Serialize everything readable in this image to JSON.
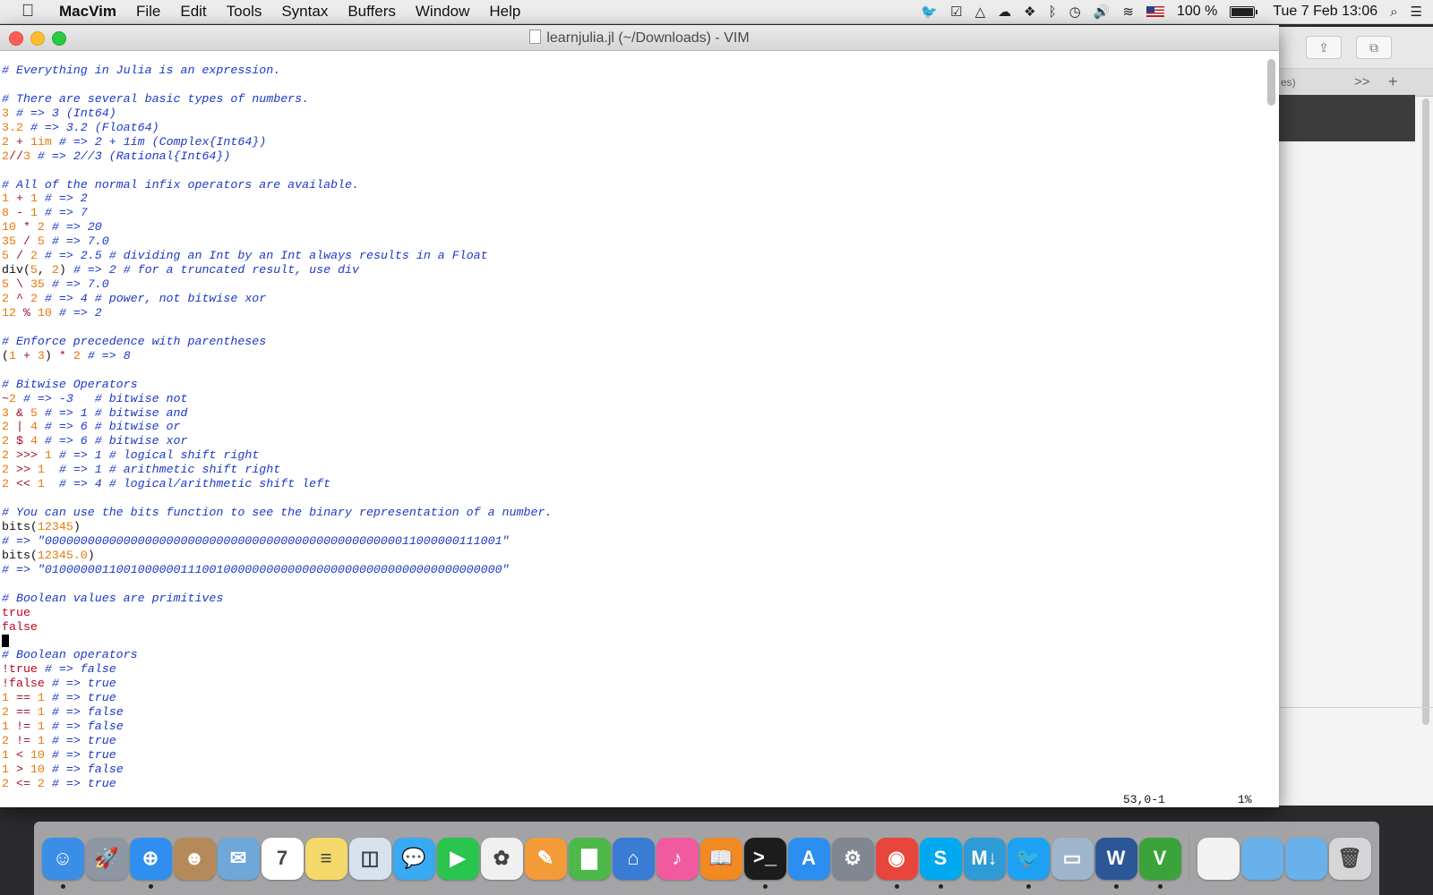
{
  "menubar": {
    "app_name": "MacVim",
    "items": [
      "File",
      "Edit",
      "Tools",
      "Syntax",
      "Buffers",
      "Window",
      "Help"
    ],
    "battery": "100 %",
    "clock": "Tue 7 Feb  13:06",
    "status_icons": [
      "twitter-icon",
      "tasks-icon",
      "drive-icon",
      "cloud-icon",
      "dropbox-icon",
      "bluetooth-icon",
      "time-machine-icon",
      "volume-icon",
      "wifi-icon",
      "flag-icon",
      "battery-icon",
      "spotlight-icon",
      "notification-center-icon"
    ]
  },
  "window": {
    "title": "learnjulia.jl (~/Downloads) - VIM"
  },
  "editor": {
    "cursor_line": 41,
    "status_position": "53,0-1",
    "status_percent": "1%",
    "lines": [
      [
        [
          "c",
          "# Everything in Julia is an expression."
        ]
      ],
      [],
      [
        [
          "c",
          "# There are several basic types of numbers."
        ]
      ],
      [
        [
          "n",
          "3"
        ],
        [
          "p",
          " "
        ],
        [
          "c",
          "# => 3 (Int64)"
        ]
      ],
      [
        [
          "n",
          "3.2"
        ],
        [
          "p",
          " "
        ],
        [
          "c",
          "# => 3.2 (Float64)"
        ]
      ],
      [
        [
          "n",
          "2"
        ],
        [
          "p",
          " "
        ],
        [
          "o",
          "+"
        ],
        [
          "p",
          " "
        ],
        [
          "n",
          "1im"
        ],
        [
          "p",
          " "
        ],
        [
          "c",
          "# => 2 + 1im (Complex{Int64})"
        ]
      ],
      [
        [
          "n",
          "2"
        ],
        [
          "o",
          "//"
        ],
        [
          "n",
          "3"
        ],
        [
          "p",
          " "
        ],
        [
          "c",
          "# => 2//3 (Rational{Int64})"
        ]
      ],
      [],
      [
        [
          "c",
          "# All of the normal infix operators are available."
        ]
      ],
      [
        [
          "n",
          "1"
        ],
        [
          "p",
          " "
        ],
        [
          "o",
          "+"
        ],
        [
          "p",
          " "
        ],
        [
          "n",
          "1"
        ],
        [
          "p",
          " "
        ],
        [
          "c",
          "# => 2"
        ]
      ],
      [
        [
          "n",
          "8"
        ],
        [
          "p",
          " "
        ],
        [
          "o",
          "-"
        ],
        [
          "p",
          " "
        ],
        [
          "n",
          "1"
        ],
        [
          "p",
          " "
        ],
        [
          "c",
          "# => 7"
        ]
      ],
      [
        [
          "n",
          "10"
        ],
        [
          "p",
          " "
        ],
        [
          "o",
          "*"
        ],
        [
          "p",
          " "
        ],
        [
          "n",
          "2"
        ],
        [
          "p",
          " "
        ],
        [
          "c",
          "# => 20"
        ]
      ],
      [
        [
          "n",
          "35"
        ],
        [
          "p",
          " "
        ],
        [
          "o",
          "/"
        ],
        [
          "p",
          " "
        ],
        [
          "n",
          "5"
        ],
        [
          "p",
          " "
        ],
        [
          "c",
          "# => 7.0"
        ]
      ],
      [
        [
          "n",
          "5"
        ],
        [
          "p",
          " "
        ],
        [
          "o",
          "/"
        ],
        [
          "p",
          " "
        ],
        [
          "n",
          "2"
        ],
        [
          "p",
          " "
        ],
        [
          "c",
          "# => 2.5 # dividing an Int by an Int always results in a Float"
        ]
      ],
      [
        [
          "p",
          "div("
        ],
        [
          "n",
          "5"
        ],
        [
          "p",
          ", "
        ],
        [
          "n",
          "2"
        ],
        [
          "p",
          ") "
        ],
        [
          "c",
          "# => 2 # for a truncated result, use div"
        ]
      ],
      [
        [
          "n",
          "5"
        ],
        [
          "p",
          " "
        ],
        [
          "o",
          "\\"
        ],
        [
          "p",
          " "
        ],
        [
          "n",
          "35"
        ],
        [
          "p",
          " "
        ],
        [
          "c",
          "# => 7.0"
        ]
      ],
      [
        [
          "n",
          "2"
        ],
        [
          "p",
          " "
        ],
        [
          "o",
          "^"
        ],
        [
          "p",
          " "
        ],
        [
          "n",
          "2"
        ],
        [
          "p",
          " "
        ],
        [
          "c",
          "# => 4 # power, not bitwise xor"
        ]
      ],
      [
        [
          "n",
          "12"
        ],
        [
          "p",
          " "
        ],
        [
          "o",
          "%"
        ],
        [
          "p",
          " "
        ],
        [
          "n",
          "10"
        ],
        [
          "p",
          " "
        ],
        [
          "c",
          "# => 2"
        ]
      ],
      [],
      [
        [
          "c",
          "# Enforce precedence with parentheses"
        ]
      ],
      [
        [
          "p",
          "("
        ],
        [
          "n",
          "1"
        ],
        [
          "p",
          " "
        ],
        [
          "o",
          "+"
        ],
        [
          "p",
          " "
        ],
        [
          "n",
          "3"
        ],
        [
          "p",
          ") "
        ],
        [
          "o",
          "*"
        ],
        [
          "p",
          " "
        ],
        [
          "n",
          "2"
        ],
        [
          "p",
          " "
        ],
        [
          "c",
          "# => 8"
        ]
      ],
      [],
      [
        [
          "c",
          "# Bitwise Operators"
        ]
      ],
      [
        [
          "o",
          "~"
        ],
        [
          "n",
          "2"
        ],
        [
          "p",
          " "
        ],
        [
          "c",
          "# => -3   # bitwise not"
        ]
      ],
      [
        [
          "n",
          "3"
        ],
        [
          "p",
          " "
        ],
        [
          "o",
          "&"
        ],
        [
          "p",
          " "
        ],
        [
          "n",
          "5"
        ],
        [
          "p",
          " "
        ],
        [
          "c",
          "# => 1 # bitwise and"
        ]
      ],
      [
        [
          "n",
          "2"
        ],
        [
          "p",
          " "
        ],
        [
          "o",
          "|"
        ],
        [
          "p",
          " "
        ],
        [
          "n",
          "4"
        ],
        [
          "p",
          " "
        ],
        [
          "c",
          "# => 6 # bitwise or"
        ]
      ],
      [
        [
          "n",
          "2"
        ],
        [
          "p",
          " "
        ],
        [
          "o",
          "$"
        ],
        [
          "p",
          " "
        ],
        [
          "n",
          "4"
        ],
        [
          "p",
          " "
        ],
        [
          "c",
          "# => 6 # bitwise xor"
        ]
      ],
      [
        [
          "n",
          "2"
        ],
        [
          "p",
          " "
        ],
        [
          "o",
          ">>>"
        ],
        [
          "p",
          " "
        ],
        [
          "n",
          "1"
        ],
        [
          "p",
          " "
        ],
        [
          "c",
          "# => 1 # logical shift right"
        ]
      ],
      [
        [
          "n",
          "2"
        ],
        [
          "p",
          " "
        ],
        [
          "o",
          ">>"
        ],
        [
          "p",
          " "
        ],
        [
          "n",
          "1"
        ],
        [
          "p",
          "  "
        ],
        [
          "c",
          "# => 1 # arithmetic shift right"
        ]
      ],
      [
        [
          "n",
          "2"
        ],
        [
          "p",
          " "
        ],
        [
          "o",
          "<<"
        ],
        [
          "p",
          " "
        ],
        [
          "n",
          "1"
        ],
        [
          "p",
          "  "
        ],
        [
          "c",
          "# => 4 # logical/arithmetic shift left"
        ]
      ],
      [],
      [
        [
          "c",
          "# You can use the bits function to see the binary representation of a number."
        ]
      ],
      [
        [
          "p",
          "bits("
        ],
        [
          "n",
          "12345"
        ],
        [
          "p",
          ")"
        ]
      ],
      [
        [
          "c",
          "# => \"0000000000000000000000000000000000000000000000000011000000111001\""
        ]
      ],
      [
        [
          "p",
          "bits("
        ],
        [
          "n",
          "12345.0"
        ],
        [
          "p",
          ")"
        ]
      ],
      [
        [
          "c",
          "# => \"0100000011001000000111001000000000000000000000000000000000000000\""
        ]
      ],
      [],
      [
        [
          "c",
          "# Boolean values are primitives"
        ]
      ],
      [
        [
          "b",
          "true"
        ]
      ],
      [
        [
          "b",
          "false"
        ]
      ],
      [],
      [
        [
          "c",
          "# Boolean operators"
        ]
      ],
      [
        [
          "o",
          "!"
        ],
        [
          "b",
          "true"
        ],
        [
          "p",
          " "
        ],
        [
          "c",
          "# => false"
        ]
      ],
      [
        [
          "o",
          "!"
        ],
        [
          "b",
          "false"
        ],
        [
          "p",
          " "
        ],
        [
          "c",
          "# => true"
        ]
      ],
      [
        [
          "n",
          "1"
        ],
        [
          "p",
          " "
        ],
        [
          "o",
          "=="
        ],
        [
          "p",
          " "
        ],
        [
          "n",
          "1"
        ],
        [
          "p",
          " "
        ],
        [
          "c",
          "# => true"
        ]
      ],
      [
        [
          "n",
          "2"
        ],
        [
          "p",
          " "
        ],
        [
          "o",
          "=="
        ],
        [
          "p",
          " "
        ],
        [
          "n",
          "1"
        ],
        [
          "p",
          " "
        ],
        [
          "c",
          "# => false"
        ]
      ],
      [
        [
          "n",
          "1"
        ],
        [
          "p",
          " "
        ],
        [
          "o",
          "!="
        ],
        [
          "p",
          " "
        ],
        [
          "n",
          "1"
        ],
        [
          "p",
          " "
        ],
        [
          "c",
          "# => false"
        ]
      ],
      [
        [
          "n",
          "2"
        ],
        [
          "p",
          " "
        ],
        [
          "o",
          "!="
        ],
        [
          "p",
          " "
        ],
        [
          "n",
          "1"
        ],
        [
          "p",
          " "
        ],
        [
          "c",
          "# => true"
        ]
      ],
      [
        [
          "n",
          "1"
        ],
        [
          "p",
          " "
        ],
        [
          "o",
          "<"
        ],
        [
          "p",
          " "
        ],
        [
          "n",
          "10"
        ],
        [
          "p",
          " "
        ],
        [
          "c",
          "# => true"
        ]
      ],
      [
        [
          "n",
          "1"
        ],
        [
          "p",
          " "
        ],
        [
          "o",
          ">"
        ],
        [
          "p",
          " "
        ],
        [
          "n",
          "10"
        ],
        [
          "p",
          " "
        ],
        [
          "c",
          "# => false"
        ]
      ],
      [
        [
          "n",
          "2"
        ],
        [
          "p",
          " "
        ],
        [
          "o",
          "<="
        ],
        [
          "p",
          " "
        ],
        [
          "n",
          "2"
        ],
        [
          "p",
          " "
        ],
        [
          "c",
          "# => true"
        ]
      ]
    ]
  },
  "background_window": {
    "tab_fragment": "es)",
    "tab_overflow": ">>",
    "tab_add": "+"
  },
  "dock": {
    "apps": [
      {
        "name": "finder-icon",
        "color": "#3a8ee6",
        "glyph": "☺",
        "running": true
      },
      {
        "name": "launchpad-icon",
        "color": "#8e96a3",
        "glyph": "🚀",
        "running": false
      },
      {
        "name": "safari-icon",
        "color": "#2f8ff0",
        "glyph": "⊕",
        "running": true
      },
      {
        "name": "contacts-icon",
        "color": "#b58a5a",
        "glyph": "☻",
        "running": false
      },
      {
        "name": "mail-icon",
        "color": "#6fa7d8",
        "glyph": "✉",
        "running": false
      },
      {
        "name": "calendar-icon",
        "color": "#ffffff",
        "glyph": "7",
        "running": false
      },
      {
        "name": "notes-icon",
        "color": "#f4d86a",
        "glyph": "≡",
        "running": false
      },
      {
        "name": "preview-icon",
        "color": "#d7e2ef",
        "glyph": "◫",
        "running": false
      },
      {
        "name": "messages-icon",
        "color": "#39a9f2",
        "glyph": "💬",
        "running": false
      },
      {
        "name": "facetime-icon",
        "color": "#2ac44f",
        "glyph": "▶",
        "running": false
      },
      {
        "name": "photos-icon",
        "color": "#f0f0f0",
        "glyph": "✿",
        "running": false
      },
      {
        "name": "pages-icon",
        "color": "#f29b38",
        "glyph": "✎",
        "running": false
      },
      {
        "name": "numbers-icon",
        "color": "#4cb848",
        "glyph": "▇",
        "running": false
      },
      {
        "name": "keynote-icon",
        "color": "#3a7bd5",
        "glyph": "⌂",
        "running": false
      },
      {
        "name": "itunes-icon",
        "color": "#f25aa0",
        "glyph": "♪",
        "running": false
      },
      {
        "name": "ibooks-icon",
        "color": "#f28a24",
        "glyph": "📖",
        "running": false
      },
      {
        "name": "terminal-icon",
        "color": "#1c1c1c",
        "glyph": ">_",
        "running": true
      },
      {
        "name": "app-store-icon",
        "color": "#2c8ef0",
        "glyph": "A",
        "running": false
      },
      {
        "name": "system-preferences-icon",
        "color": "#808790",
        "glyph": "⚙",
        "running": false
      },
      {
        "name": "chrome-icon",
        "color": "#e8453c",
        "glyph": "◉",
        "running": true
      },
      {
        "name": "skype-icon",
        "color": "#00a9f0",
        "glyph": "S",
        "running": true
      },
      {
        "name": "markdown-icon",
        "color": "#2e9ad6",
        "glyph": "M↓",
        "running": false
      },
      {
        "name": "twitter-app-icon",
        "color": "#1da1f2",
        "glyph": "🐦",
        "running": true
      },
      {
        "name": "image-capture-icon",
        "color": "#9fb5cc",
        "glyph": "▭",
        "running": false
      },
      {
        "name": "word-icon",
        "color": "#2b5797",
        "glyph": "W",
        "running": true
      },
      {
        "name": "macvim-icon",
        "color": "#3aa33a",
        "glyph": "V",
        "running": true
      },
      {
        "name": "separator",
        "color": "",
        "glyph": "",
        "running": false
      },
      {
        "name": "document-icon",
        "color": "#f2f2f2",
        "glyph": "",
        "running": false
      },
      {
        "name": "applications-folder-icon",
        "color": "#68b1ea",
        "glyph": "",
        "running": false
      },
      {
        "name": "downloads-folder-icon",
        "color": "#68b1ea",
        "glyph": "",
        "running": false
      },
      {
        "name": "trash-icon",
        "color": "#d4d6d8",
        "glyph": "🗑",
        "running": false
      }
    ]
  }
}
